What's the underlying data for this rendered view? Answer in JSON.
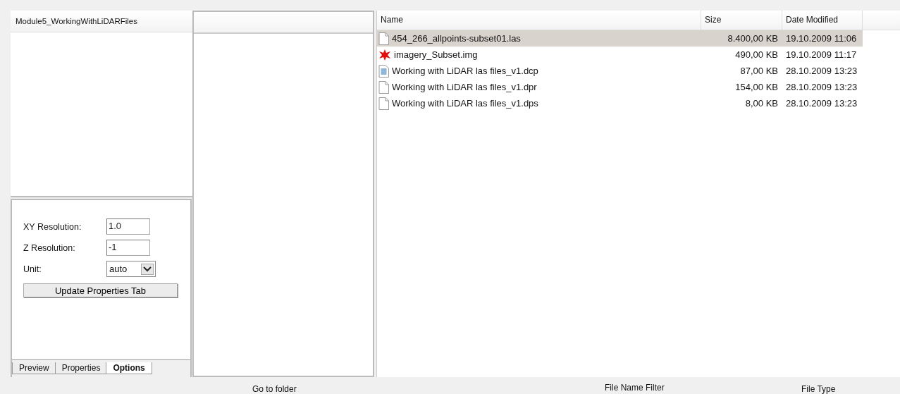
{
  "folder_tree": {
    "header": "Module5_WorkingWithLiDARFiles"
  },
  "options": {
    "fields": [
      {
        "kind": "text",
        "label": "XY Resolution:",
        "value": "1.0"
      },
      {
        "kind": "text",
        "label": "Z Resolution:",
        "value": "-1"
      },
      {
        "kind": "select",
        "label": "Unit:",
        "value": "auto"
      }
    ],
    "button": "Update Properties Tab",
    "tabs": [
      {
        "label": "Preview",
        "selected": false
      },
      {
        "label": "Properties",
        "selected": false
      },
      {
        "label": "Options",
        "selected": true
      }
    ]
  },
  "file_list": {
    "columns": [
      "Name",
      "Size",
      "Date Modified"
    ],
    "rows": [
      {
        "kind": "blank",
        "name": "454_266_allpoints-subset01.las",
        "size": "8.400,00 KB",
        "date": "19.10.2009 11:06",
        "selected": true
      },
      {
        "kind": "raster",
        "name": "imagery_Subset.img",
        "size": "490,00 KB",
        "date": "19.10.2009 11:17",
        "selected": false
      },
      {
        "kind": "doc",
        "name": "Working with LiDAR las files_v1.dcp",
        "size": "87,00 KB",
        "date": "28.10.2009 13:23",
        "selected": false
      },
      {
        "kind": "blank",
        "name": "Working with LiDAR las files_v1.dpr",
        "size": "154,00 KB",
        "date": "28.10.2009 13:23",
        "selected": false
      },
      {
        "kind": "blank",
        "name": "Working with LiDAR las files_v1.dps",
        "size": "8,00 KB",
        "date": "28.10.2009 13:23",
        "selected": false
      }
    ]
  },
  "footer": {
    "labels": [
      "Go to folder",
      "File Name Filter",
      "File Type"
    ]
  }
}
